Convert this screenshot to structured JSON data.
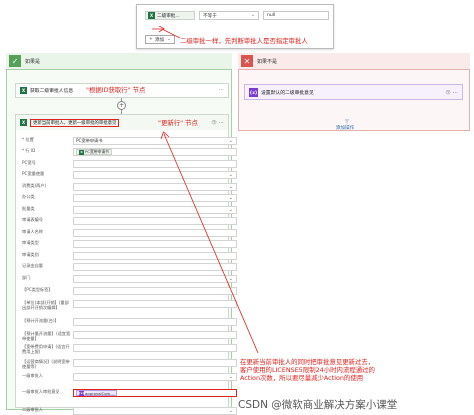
{
  "condition": {
    "token": "二级审批...",
    "operator": "不等于",
    "value": "null",
    "add_label": "添加"
  },
  "annotation_top": "二级审批一样，先判断审批人是否指定审批人",
  "yes_branch": {
    "title": "如果是",
    "get_row_card": "获取二级审批人信息",
    "get_row_annotation": "\"根据ID获取行\" 节点",
    "update_card": "更新当前审批人，更新一级审批的审批意见",
    "update_annotation": "\"更新行\" 节点",
    "fields": [
      {
        "label": "* 位置",
        "value": "PC宽带申请书",
        "tag": false,
        "dropdown": true
      },
      {
        "label": "* 行 ID",
        "value": "PC宽带申请书",
        "tag": true,
        "dropdown": false
      },
      {
        "label": "PC宽号",
        "value": "",
        "tag": false,
        "dropdown": false
      },
      {
        "label": "PC宽量使量",
        "value": "",
        "tag": false,
        "dropdown": true
      },
      {
        "label": "消费类(两户)",
        "value": "",
        "tag": false,
        "dropdown": true
      },
      {
        "label": "办公类",
        "value": "",
        "tag": false,
        "dropdown": true
      },
      {
        "label": "批量类",
        "value": "",
        "tag": false,
        "dropdown": true
      },
      {
        "label": "审请表编号",
        "value": "",
        "tag": false,
        "dropdown": false
      },
      {
        "label": "审请人名称",
        "value": "",
        "tag": false,
        "dropdown": false
      },
      {
        "label": "审请类型",
        "value": "",
        "tag": false,
        "dropdown": false
      },
      {
        "label": "审请类别",
        "value": "",
        "tag": false,
        "dropdown": false
      },
      {
        "label": "记录由自量",
        "value": "",
        "tag": false,
        "dropdown": false
      },
      {
        "label": "部门",
        "value": "",
        "tag": false,
        "dropdown": true
      },
      {
        "label": "【PC类型标签】",
        "value": "",
        "tag": false,
        "dropdown": false
      },
      {
        "label": "【单位(本部)开销】(量部出部开开销次编辑】",
        "value": "",
        "tag": false,
        "dropdown": false
      },
      {
        "label": "【预计开流量(台)】",
        "value": "",
        "tag": false,
        "dropdown": false
      },
      {
        "label": "【预计量开流量】（适宜宽带使量】",
        "value": "",
        "tag": false,
        "dropdown": false
      },
      {
        "label": "【宽带费用申请】(适宜开费用上限)",
        "value": "",
        "tag": false,
        "dropdown": false
      },
      {
        "label": "【运营商情况】(说明宽带使量等)",
        "value": "",
        "tag": false,
        "dropdown": false
      },
      {
        "label": "一级审批人",
        "value": "",
        "tag": false,
        "dropdown": true
      },
      {
        "label": "一级审批人审批意见",
        "value": "approvalCom...",
        "tag": true,
        "dropdown": false
      },
      {
        "label": "二级审批人",
        "value": "",
        "tag": false,
        "dropdown": true
      }
    ]
  },
  "no_branch": {
    "title": "如果不是",
    "card": "设置默认的二级审批意见",
    "add_action": "添加操作"
  },
  "annotation_bottom_lines": [
    "在更新当前审批人的同时把审批意见更新过去，",
    "客户使用的LICENSE5限制24小时内流程通过的",
    "Action次数，所以要尽量减少Action的使用"
  ],
  "watermark": "CSDN @微软商业解决方案小课堂",
  "colors": {
    "accent_red": "#e0221c",
    "green": "#1f7a3c",
    "yes_green": "#57a05a",
    "no_red": "#d9534f",
    "purple": "#7a3bd1",
    "blue": "#2b6cb0"
  }
}
